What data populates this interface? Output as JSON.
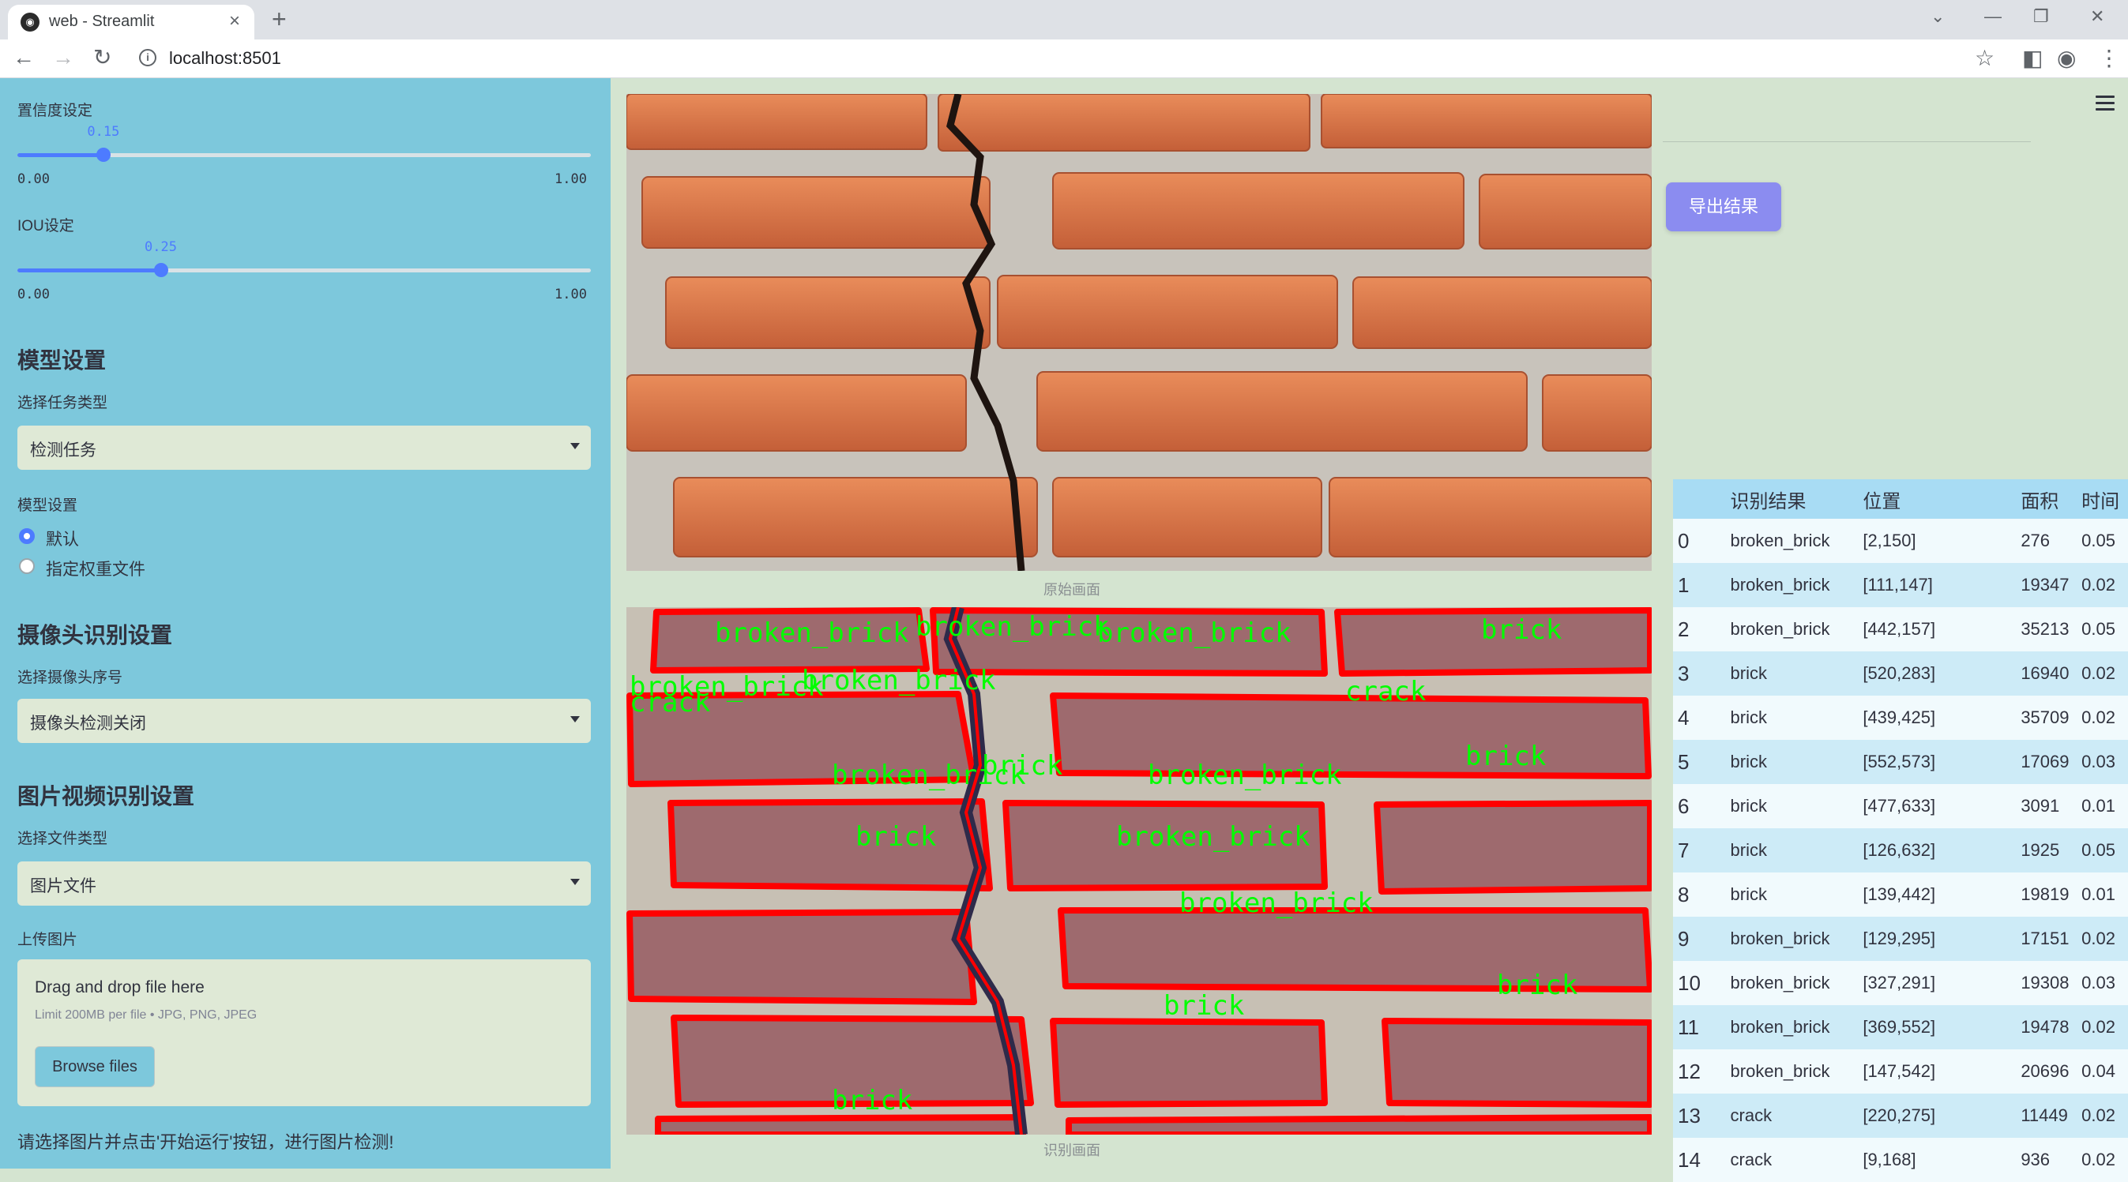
{
  "browser": {
    "tab_title": "web - Streamlit",
    "url": "localhost:8501"
  },
  "sidebar": {
    "confidence": {
      "label": "置信度设定",
      "value": "0.15",
      "value_num": 0.15,
      "min": "0.00",
      "max": "1.00"
    },
    "iou": {
      "label": "IOU设定",
      "value": "0.25",
      "value_num": 0.25,
      "min": "0.00",
      "max": "1.00"
    },
    "model_section": {
      "heading": "模型设置",
      "task_label": "选择任务类型",
      "task_value": "检测任务",
      "model_label": "模型设置",
      "options": [
        "默认",
        "指定权重文件"
      ],
      "selected": "默认"
    },
    "camera_section": {
      "heading": "摄像头识别设置",
      "label": "选择摄像头序号",
      "value": "摄像头检测关闭"
    },
    "file_section": {
      "heading": "图片视频识别设置",
      "type_label": "选择文件类型",
      "type_value": "图片文件",
      "upload_label": "上传图片",
      "drop_text": "Drag and drop file here",
      "limit_text": "Limit 200MB per file • JPG, PNG, JPEG",
      "browse_label": "Browse files"
    },
    "note": "请选择图片并点击'开始运行'按钮，进行图片检测!"
  },
  "main": {
    "original_caption": "原始画面",
    "detected_caption": "识别画面",
    "export_label": "导出结果",
    "detections": [
      {
        "cls": "broken_brick"
      },
      {
        "cls": "broken_brick"
      },
      {
        "cls": "broken_brick"
      },
      {
        "cls": "brick"
      },
      {
        "cls": "broken_brick"
      },
      {
        "cls": "broken_brick"
      },
      {
        "cls": "crack"
      },
      {
        "cls": "crack"
      },
      {
        "cls": "broken_brick"
      },
      {
        "cls": "broken_brick"
      },
      {
        "cls": "brick"
      },
      {
        "cls": "brick"
      },
      {
        "cls": "brick"
      },
      {
        "cls": "broken_brick"
      },
      {
        "cls": "broken_brick"
      },
      {
        "cls": "brick"
      },
      {
        "cls": "brick"
      },
      {
        "cls": "brick"
      }
    ],
    "table": {
      "headers": [
        "",
        "识别结果",
        "位置",
        "面积",
        "时间"
      ],
      "rows": [
        [
          "0",
          "broken_brick",
          "[2,150]",
          "276",
          "0.05"
        ],
        [
          "1",
          "broken_brick",
          "[111,147]",
          "19347",
          "0.02"
        ],
        [
          "2",
          "broken_brick",
          "[442,157]",
          "35213",
          "0.05"
        ],
        [
          "3",
          "brick",
          "[520,283]",
          "16940",
          "0.02"
        ],
        [
          "4",
          "brick",
          "[439,425]",
          "35709",
          "0.02"
        ],
        [
          "5",
          "brick",
          "[552,573]",
          "17069",
          "0.03"
        ],
        [
          "6",
          "brick",
          "[477,633]",
          "3091",
          "0.01"
        ],
        [
          "7",
          "brick",
          "[126,632]",
          "1925",
          "0.05"
        ],
        [
          "8",
          "brick",
          "[139,442]",
          "19819",
          "0.01"
        ],
        [
          "9",
          "broken_brick",
          "[129,295]",
          "17151",
          "0.02"
        ],
        [
          "10",
          "broken_brick",
          "[327,291]",
          "19308",
          "0.03"
        ],
        [
          "11",
          "broken_brick",
          "[369,552]",
          "19478",
          "0.02"
        ],
        [
          "12",
          "broken_brick",
          "[147,542]",
          "20696",
          "0.04"
        ],
        [
          "13",
          "crack",
          "[220,275]",
          "11449",
          "0.02"
        ],
        [
          "14",
          "crack",
          "[9,168]",
          "936",
          "0.02"
        ]
      ]
    }
  },
  "colors": {
    "sidebar_bg": "#7dc8dc",
    "main_bg": "#d4e4d0",
    "accent": "#4d7bff",
    "export_button": "#8b8cf0",
    "table_header": "#a8dcf4",
    "detection_box": "#ff0000",
    "detection_label": "#00ff00"
  }
}
